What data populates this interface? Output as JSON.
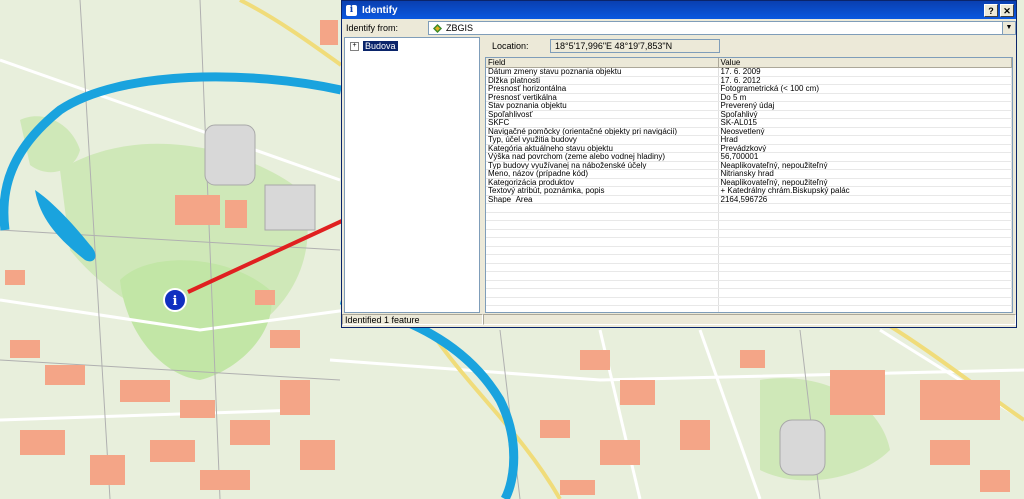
{
  "window": {
    "title": "Identify",
    "close_label": "✕",
    "help_label": "?"
  },
  "identify_from": {
    "label": "Identify from:",
    "value": "ZBGIS"
  },
  "tree": {
    "node_label": "Budova",
    "expander": "+"
  },
  "location": {
    "label": "Location:",
    "value": "18°5'17,996\"E  48°19'7,853\"N"
  },
  "grid": {
    "headers": [
      "Field",
      "Value"
    ],
    "rows": [
      [
        "Dátum zmeny stavu poznania objektu",
        "17. 6. 2009"
      ],
      [
        "Dĺžka platnosti",
        "17. 6. 2012"
      ],
      [
        "Presnosť horizontálna",
        "Fotogrametrická (< 100 cm)"
      ],
      [
        "Presnosť vertikálna",
        "Do 5 m"
      ],
      [
        "Stav poznania objektu",
        "Preverený údaj"
      ],
      [
        "Spoľahlivosť",
        "Spoľahlivý"
      ],
      [
        "SKFC",
        "SK-AL015"
      ],
      [
        "Navigačné pomôcky (orientačné objekty pri navigácii)",
        "Neosvetlený"
      ],
      [
        "Typ, účel využitia budovy",
        "Hrad"
      ],
      [
        "Kategória aktuálneho stavu objektu",
        "Prevádzkový"
      ],
      [
        "Výška nad povrchom (zeme alebo vodnej hladiny)",
        "56,700001"
      ],
      [
        "Typ budovy využívanej na náboženské účely",
        "Neaplikovateľný, nepoužiteľný"
      ],
      [
        "Meno, názov (prípadne kód)",
        "Nitriansky hrad"
      ],
      [
        "Kategorizácia produktov",
        "Neaplikovateľný, nepoužiteľný"
      ],
      [
        "Textový atribút, poznámka, popis",
        "+ Katedrálny chrám.Biskupský palác"
      ],
      [
        "Shape_Area",
        "2164,596726"
      ]
    ],
    "empty_rows": 14
  },
  "status": {
    "text": "Identified 1 feature"
  },
  "map": {
    "marker_label": "i",
    "river_color": "#1aa3de",
    "building_color": "#f4a587",
    "arrow_color": "#e02020"
  }
}
